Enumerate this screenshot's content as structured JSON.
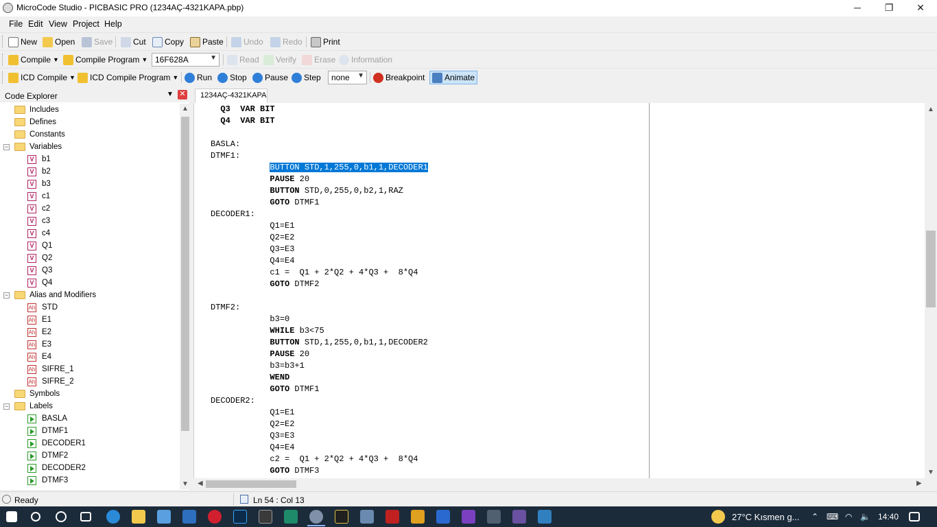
{
  "window": {
    "title": "MicroCode Studio - PICBASIC PRO (1234AÇ-4321KAPA.pbp)",
    "minimize": "─",
    "restore": "❐",
    "close": "✕"
  },
  "menu": [
    "File",
    "Edit",
    "View",
    "Project",
    "Help"
  ],
  "toolbar1": {
    "new": "New",
    "open": "Open",
    "save": "Save",
    "cut": "Cut",
    "copy": "Copy",
    "paste": "Paste",
    "undo": "Undo",
    "redo": "Redo",
    "print": "Print"
  },
  "toolbar2": {
    "compile": "Compile",
    "compile_program": "Compile Program",
    "device": "16F628A",
    "read": "Read",
    "verify": "Verify",
    "erase": "Erase",
    "information": "Information"
  },
  "toolbar3": {
    "icd_compile": "ICD Compile",
    "icd_compile_program": "ICD Compile Program",
    "run": "Run",
    "stop": "Stop",
    "pause": "Pause",
    "step": "Step",
    "step_mode": "none",
    "breakpoint": "Breakpoint",
    "animate": "Animate"
  },
  "explorer": {
    "title": "Code Explorer",
    "close": "✕",
    "groups": {
      "includes": "Includes",
      "defines": "Defines",
      "constants": "Constants",
      "variables": "Variables",
      "alias": "Alias and Modifiers",
      "symbols": "Symbols",
      "labels": "Labels"
    },
    "variables": [
      "b1",
      "b2",
      "b3",
      "c1",
      "c2",
      "c3",
      "c4",
      "Q1",
      "Q2",
      "Q3",
      "Q4"
    ],
    "aliases": [
      "STD",
      "E1",
      "E2",
      "E3",
      "E4",
      "SIFRE_1",
      "SIFRE_2"
    ],
    "labels": [
      "BASLA",
      "DTMF1",
      "DECODER1",
      "DTMF2",
      "DECODER2",
      "DTMF3"
    ]
  },
  "editor": {
    "tab": "1234AÇ-4321KAPA",
    "lines": [
      {
        "indent": "  ",
        "kw": "",
        "text": "Q3  VAR BIT",
        "bold": true
      },
      {
        "indent": "  ",
        "kw": "",
        "text": "Q4  VAR BIT",
        "bold": true
      },
      {
        "indent": "",
        "kw": "",
        "text": ""
      },
      {
        "indent": "",
        "kw": "",
        "text": "BASLA:"
      },
      {
        "indent": "",
        "kw": "",
        "text": "DTMF1:"
      },
      {
        "indent": "            ",
        "kw": "",
        "text": "BUTTON STD,1,255,0,b1,1,DECODER1",
        "selected": true
      },
      {
        "indent": "            ",
        "kw": "PAUSE",
        "text": " 20"
      },
      {
        "indent": "            ",
        "kw": "BUTTON",
        "text": " STD,0,255,0,b2,1,RAZ"
      },
      {
        "indent": "            ",
        "kw": "GOTO",
        "text": " DTMF1"
      },
      {
        "indent": "",
        "kw": "",
        "text": "DECODER1:"
      },
      {
        "indent": "            ",
        "kw": "",
        "text": "Q1=E1"
      },
      {
        "indent": "            ",
        "kw": "",
        "text": "Q2=E2"
      },
      {
        "indent": "            ",
        "kw": "",
        "text": "Q3=E3"
      },
      {
        "indent": "            ",
        "kw": "",
        "text": "Q4=E4"
      },
      {
        "indent": "            ",
        "kw": "",
        "text": "c1 =  Q1 + 2*Q2 + 4*Q3 +  8*Q4"
      },
      {
        "indent": "            ",
        "kw": "GOTO",
        "text": " DTMF2"
      },
      {
        "indent": "",
        "kw": "",
        "text": ""
      },
      {
        "indent": "",
        "kw": "",
        "text": "DTMF2:"
      },
      {
        "indent": "            ",
        "kw": "",
        "text": "b3=0"
      },
      {
        "indent": "            ",
        "kw": "WHILE",
        "text": " b3<75"
      },
      {
        "indent": "            ",
        "kw": "BUTTON",
        "text": " STD,1,255,0,b1,1,DECODER2"
      },
      {
        "indent": "            ",
        "kw": "PAUSE",
        "text": " 20"
      },
      {
        "indent": "            ",
        "kw": "",
        "text": "b3=b3+1"
      },
      {
        "indent": "            ",
        "kw": "WEND",
        "text": ""
      },
      {
        "indent": "            ",
        "kw": "GOTO",
        "text": " DTMF1"
      },
      {
        "indent": "",
        "kw": "",
        "text": "DECODER2:"
      },
      {
        "indent": "            ",
        "kw": "",
        "text": "Q1=E1"
      },
      {
        "indent": "            ",
        "kw": "",
        "text": "Q2=E2"
      },
      {
        "indent": "            ",
        "kw": "",
        "text": "Q3=E3"
      },
      {
        "indent": "            ",
        "kw": "",
        "text": "Q4=E4"
      },
      {
        "indent": "            ",
        "kw": "",
        "text": "c2 =  Q1 + 2*Q2 + 4*Q3 +  8*Q4"
      },
      {
        "indent": "            ",
        "kw": "GOTO",
        "text": " DTMF3"
      }
    ]
  },
  "status": {
    "ready": "Ready",
    "position": "Ln 54 : Col 13"
  },
  "taskbar": {
    "weather": "27°C  Kısmen g...",
    "time": "14:40"
  }
}
